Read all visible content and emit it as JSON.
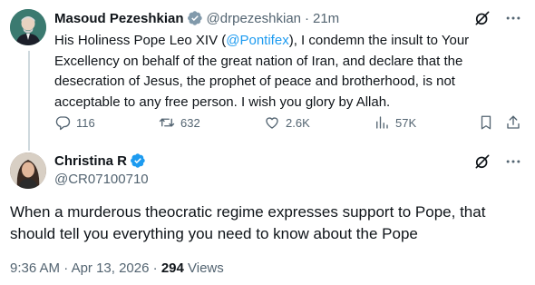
{
  "parent_tweet": {
    "author_name": "Masoud Pezeshkian",
    "handle": "@drpezeshkian",
    "separator": "·",
    "time": "21m",
    "text_before_mention": "His Holiness Pope Leo XIV (",
    "mention": "@Pontifex",
    "text_after_mention": "), I condemn the insult to Your Excellency on behalf of the great nation of Iran, and declare that the desecration of Jesus, the prophet of peace and brotherhood, is not acceptable to any free person. I wish you glory by Allah.",
    "replies": "116",
    "reposts": "632",
    "likes": "2.6K",
    "views": "57K"
  },
  "main_tweet": {
    "author_name": "Christina R",
    "handle": "@CR07100710",
    "text": "When a murderous theocratic regime expresses support to Pope, that should tell you everything you need to know about the Pope",
    "time": "9:36 AM",
    "separator": "·",
    "date": "Apr 13, 2026",
    "views_count": "294",
    "views_label": "Views"
  },
  "colors": {
    "accent": "#1d9bf0",
    "text": "#0f1419",
    "secondary": "#536471",
    "thread_line": "#cfd9de"
  },
  "icons": {
    "verified": "verified-badge-icon",
    "grok": "grok-icon",
    "more": "more-icon",
    "reply": "reply-icon",
    "repost": "repost-icon",
    "like": "heart-icon",
    "views": "views-icon",
    "bookmark": "bookmark-icon",
    "share": "share-icon"
  }
}
